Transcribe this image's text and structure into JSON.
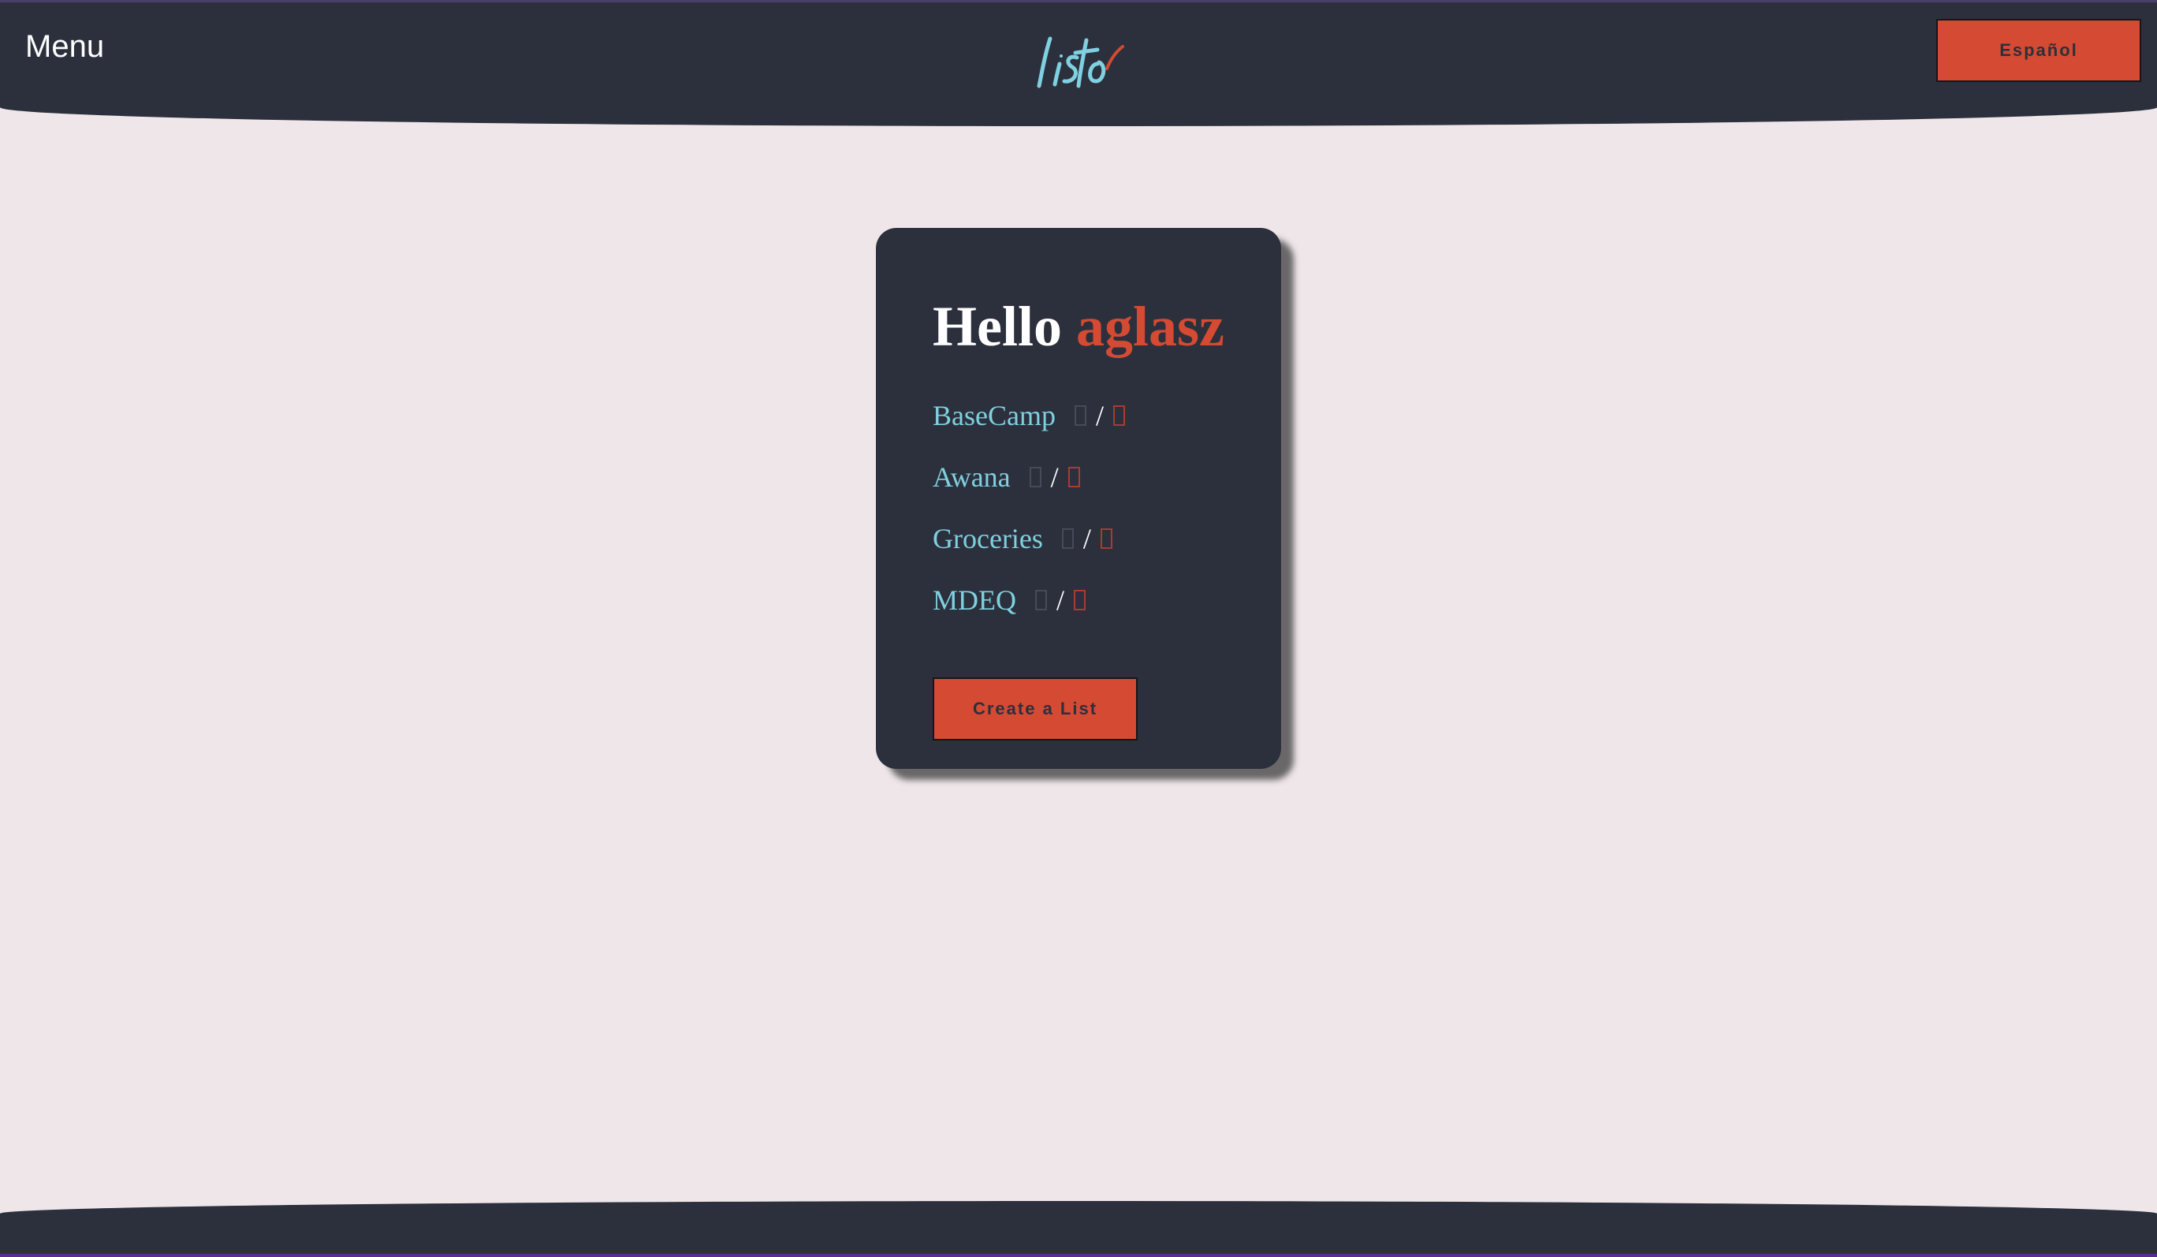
{
  "header": {
    "menu_label": "Menu",
    "logo_text": "listo",
    "language_button": "Español"
  },
  "card": {
    "greeting": "Hello",
    "username": "aglasz",
    "lists": [
      {
        "name": "BaseCamp",
        "separator": "/"
      },
      {
        "name": "Awana",
        "separator": "/"
      },
      {
        "name": "Groceries",
        "separator": "/"
      },
      {
        "name": "MDEQ",
        "separator": "/"
      }
    ],
    "create_button": "Create a List"
  },
  "icons": {
    "edit": "edit-icon",
    "delete": "delete-icon"
  },
  "colors": {
    "accent": "#d44a33",
    "link": "#7fd0e0",
    "dark": "#2c303c",
    "background": "#efe6e9"
  }
}
